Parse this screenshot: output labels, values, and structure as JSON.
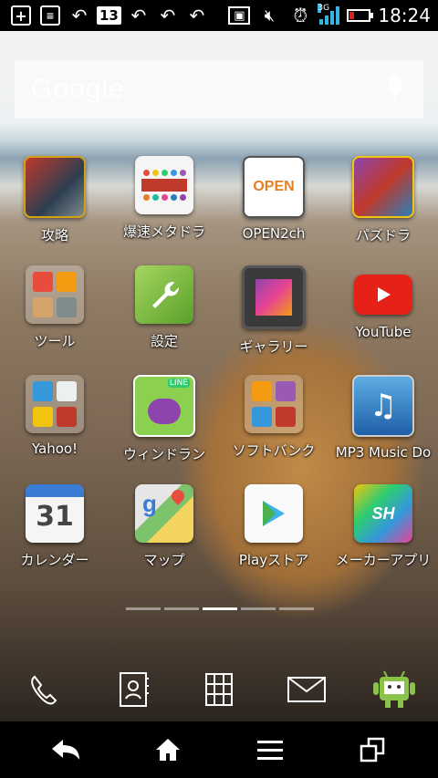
{
  "status_bar": {
    "time": "18:24",
    "notification_badge": "13",
    "network": "3G",
    "battery_level": 0.2
  },
  "search": {
    "logo_text": "Google"
  },
  "apps": [
    {
      "label": "攻略"
    },
    {
      "label": "爆速メタドラ"
    },
    {
      "label": "OPEN2ch",
      "icon_text": "OPEN"
    },
    {
      "label": "パズドラ"
    },
    {
      "label": "ツール"
    },
    {
      "label": "設定"
    },
    {
      "label": "ギャラリー"
    },
    {
      "label": "YouTube"
    },
    {
      "label": "Yahoo!"
    },
    {
      "label": "ウィンドラン",
      "icon_text": "LINE"
    },
    {
      "label": "ソフトバンク"
    },
    {
      "label": "MP3 Music Do"
    },
    {
      "label": "カレンダー",
      "icon_text": "31"
    },
    {
      "label": "マップ"
    },
    {
      "label": "Playストア"
    },
    {
      "label": "メーカーアプリ",
      "icon_text": "SH"
    }
  ],
  "page_indicator": {
    "pages": 5,
    "current": 3
  },
  "dock": [
    "phone-icon",
    "contacts-icon",
    "app-drawer-icon",
    "mail-icon",
    "android-icon"
  ],
  "nav": [
    "back-icon",
    "home-icon",
    "menu-icon",
    "recent-apps-icon"
  ]
}
